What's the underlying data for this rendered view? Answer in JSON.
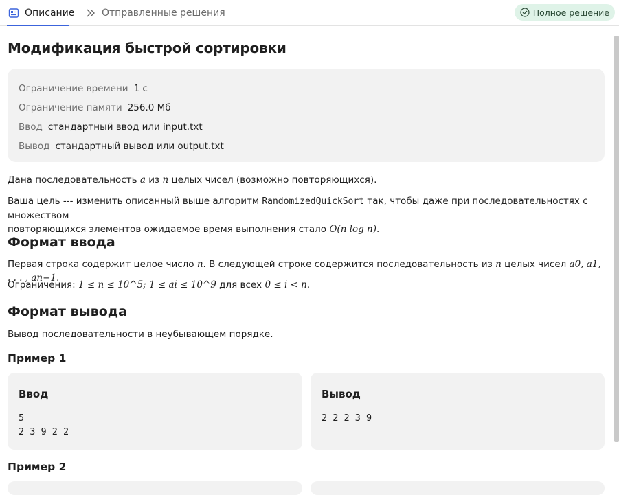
{
  "tabs": [
    {
      "label": "Описание",
      "icon": "description-icon",
      "active": true
    },
    {
      "label": "Отправленные решения",
      "icon": "double-chevron-icon",
      "active": false
    }
  ],
  "status_badge": {
    "label": "Полное решение",
    "icon": "check-circle-icon",
    "color": "#dff3e8"
  },
  "problem": {
    "title": "Модификация быстрой сортировки",
    "limits": [
      {
        "key": "Ограничение времени",
        "value": "1 с"
      },
      {
        "key": "Ограничение памяти",
        "value": "256.0 Мб"
      },
      {
        "key": "Ввод",
        "value": "стандартный ввод или input.txt"
      },
      {
        "key": "Вывод",
        "value": "стандартный вывод или output.txt"
      }
    ],
    "statement": {
      "p1_a": "Дана последовательность",
      "p1_var_a": "a",
      "p1_b": "из",
      "p1_var_n": "n",
      "p1_c": "целых чисел (возможно повторяющихся).",
      "p2_a": "Ваша цель --- изменить описанный выше алгоритм",
      "p2_code": "RandomizedQuickSort",
      "p2_b": "так, чтобы даже при последовательностях с множеством",
      "p2_c": "повторяющихся элементов ожидаемое время выполнения стало",
      "p2_formula": "O(n log n)",
      "p2_end": "."
    },
    "input_format": {
      "heading": "Формат ввода",
      "line1_a": "Первая строка содержит целое число",
      "line1_var": "n",
      "line1_b": ". В следующей строке содержится последовательность из",
      "line1_var2": "n",
      "line1_c": "целых чисел",
      "line1_seq": "a0, a1, . . . , an−1",
      "line1_end": ".",
      "constraints_label": "Ограничения:",
      "constraints_formula": "1 ≤ n ≤ 10^5; 1 ≤ ai ≤ 10^9",
      "constraints_mid": "для всех",
      "constraints_formula2": "0 ≤ i < n",
      "constraints_end": "."
    },
    "output_format": {
      "heading": "Формат вывода",
      "text": "Вывод последовательности в неубывающем порядке."
    },
    "examples": [
      {
        "title": "Пример 1",
        "input_label": "Ввод",
        "input": "5\n2 3 9 2 2",
        "output_label": "Вывод",
        "output": "2 2 2 3 9"
      },
      {
        "title": "Пример 2"
      }
    ]
  }
}
